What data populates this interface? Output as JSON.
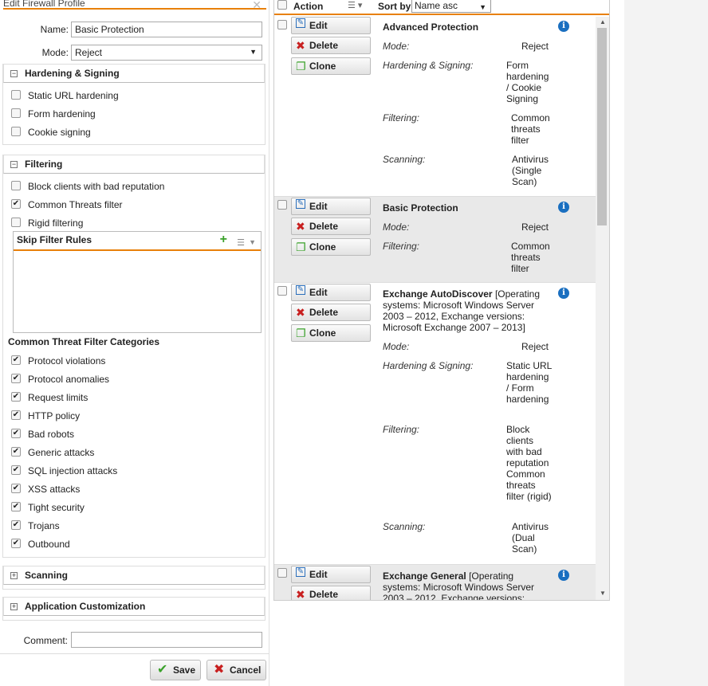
{
  "dialog": {
    "title": "Edit Firewall Profile",
    "name_label": "Name:",
    "name_value": "Basic Protection",
    "mode_label": "Mode:",
    "mode_value": "Reject",
    "hardening": {
      "title": "Hardening & Signing",
      "items": [
        {
          "label": "Static URL hardening",
          "checked": false
        },
        {
          "label": "Form hardening",
          "checked": false
        },
        {
          "label": "Cookie signing",
          "checked": false
        }
      ]
    },
    "filtering": {
      "title": "Filtering",
      "items": [
        {
          "label": "Block clients with bad reputation",
          "checked": false
        },
        {
          "label": "Common Threats filter",
          "checked": true
        },
        {
          "label": "Rigid filtering",
          "checked": false
        }
      ],
      "skip_rules_title": "Skip Filter Rules",
      "categories_title": "Common Threat Filter Categories",
      "categories": [
        {
          "label": "Protocol violations",
          "checked": true
        },
        {
          "label": "Protocol anomalies",
          "checked": true
        },
        {
          "label": "Request limits",
          "checked": true
        },
        {
          "label": "HTTP policy",
          "checked": true
        },
        {
          "label": "Bad robots",
          "checked": true
        },
        {
          "label": "Generic attacks",
          "checked": true
        },
        {
          "label": "SQL injection attacks",
          "checked": true
        },
        {
          "label": "XSS attacks",
          "checked": true
        },
        {
          "label": "Tight security",
          "checked": true
        },
        {
          "label": "Trojans",
          "checked": true
        },
        {
          "label": "Outbound",
          "checked": true
        }
      ]
    },
    "scanning_title": "Scanning",
    "app_custom_title": "Application Customization",
    "comment_label": "Comment:",
    "comment_value": "",
    "save_label": "Save",
    "cancel_label": "Cancel"
  },
  "grid": {
    "action_label": "Action",
    "sortby_label": "Sort by:",
    "sort_value": "Name asc",
    "edit_label": "Edit",
    "delete_label": "Delete",
    "clone_label": "Clone",
    "profiles": [
      {
        "name": "Advanced Protection",
        "extra": "",
        "props": [
          {
            "label": "Mode:",
            "value": "Reject"
          },
          {
            "label": "Hardening & Signing:",
            "value": "Form hardening / Cookie Signing"
          },
          {
            "label": "Filtering:",
            "value": "Common threats filter"
          },
          {
            "label": "Scanning:",
            "value": "Antivirus (Single Scan)"
          }
        ]
      },
      {
        "name": "Basic Protection",
        "extra": "",
        "props": [
          {
            "label": "Mode:",
            "value": "Reject"
          },
          {
            "label": "Filtering:",
            "value": "Common threats filter"
          }
        ]
      },
      {
        "name": "Exchange AutoDiscover",
        "extra": "[Operating systems: Microsoft Windows Server 2003 – 2012, Exchange versions: Microsoft Exchange 2007 – 2013]",
        "props": [
          {
            "label": "Mode:",
            "value": "Reject"
          },
          {
            "label": "Hardening & Signing:",
            "value": "Static URL hardening / Form hardening"
          },
          {
            "label": "Filtering:",
            "value": "Block clients with bad reputation Common threats filter (rigid)"
          },
          {
            "label": "Scanning:",
            "value": "Antivirus (Dual Scan)"
          }
        ]
      },
      {
        "name": "Exchange General",
        "extra": "[Operating systems: Microsoft Windows Server 2003 – 2012, Exchange versions:",
        "props": []
      }
    ]
  }
}
